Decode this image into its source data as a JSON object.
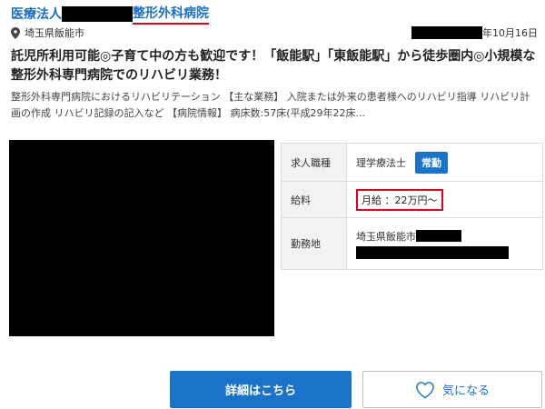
{
  "job": {
    "employer_prefix": "医療法人",
    "employer_suffix": "整形外科病院",
    "location": "埼玉県飯能市",
    "date_suffix": "年10月16日",
    "headline": "託児所利用可能◎子育て中の方も歓迎です！「飯能駅」「東飯能駅」から徒歩圏内◎小規模な整形外科専門病院でのリハビリ業務！",
    "description": "整形外科専門病院におけるリハビリテーション 【主な業務】 入院または外来の患者様へのリハビリ指導 リハビリ計画の作成 リハビリ記録の記入など 【病院情報】 病床数:57床(平成29年22床..."
  },
  "details": {
    "occupation_label": "求人職種",
    "occupation_value": "理学療法士",
    "employment_type": "常勤",
    "salary_label": "給料",
    "salary_value": "月給 ：22万円〜",
    "workplace_label": "勤務地",
    "workplace_value": "埼玉県飯能市"
  },
  "actions": {
    "detail_label": "詳細はこちら",
    "favorite_label": "気になる"
  },
  "colors": {
    "link_blue": "#1a6fc4",
    "button_blue": "#1a73c8",
    "highlight_red": "#e0001a"
  }
}
